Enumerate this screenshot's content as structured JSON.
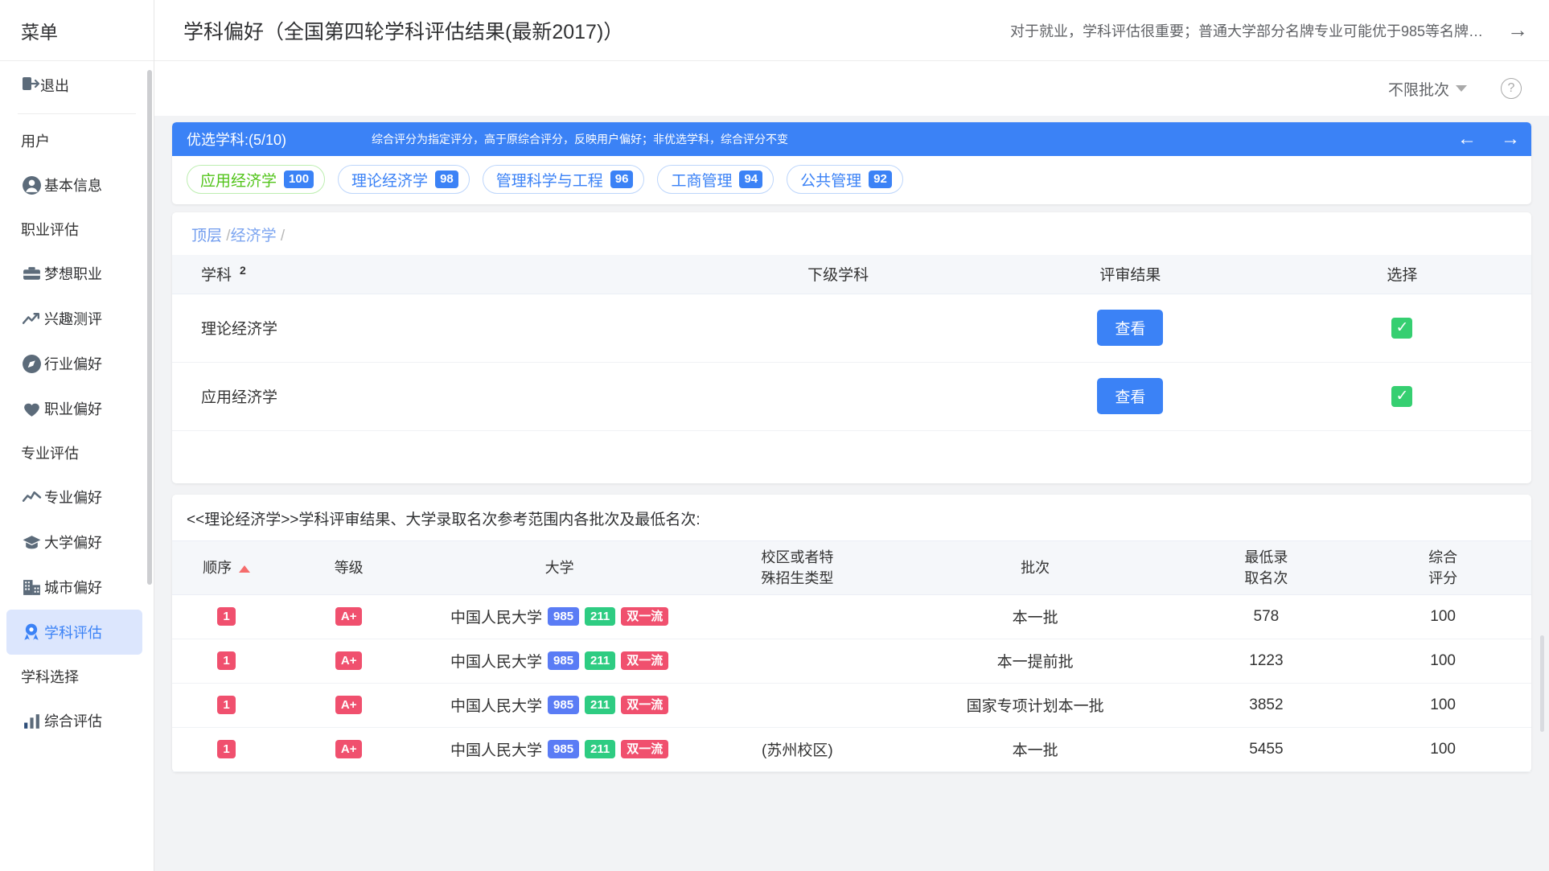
{
  "sidebar": {
    "header_label": "菜单",
    "logout_label": "退出",
    "groups": [
      {
        "title": "用户",
        "items": [
          {
            "label": "基本信息",
            "icon": "user-circle-icon",
            "active": false
          }
        ]
      },
      {
        "title": "职业评估",
        "items": [
          {
            "label": "梦想职业",
            "icon": "briefcase-icon",
            "active": false
          },
          {
            "label": "兴趣测评",
            "icon": "trend-up-icon",
            "active": false
          },
          {
            "label": "行业偏好",
            "icon": "compass-icon",
            "active": false
          },
          {
            "label": "职业偏好",
            "icon": "heart-icon",
            "active": false
          }
        ]
      },
      {
        "title": "专业评估",
        "items": [
          {
            "label": "专业偏好",
            "icon": "line-chart-icon",
            "active": false
          },
          {
            "label": "大学偏好",
            "icon": "graduation-cap-icon",
            "active": false
          },
          {
            "label": "城市偏好",
            "icon": "building-icon",
            "active": false
          },
          {
            "label": "学科评估",
            "icon": "award-badge-icon",
            "active": true
          }
        ]
      },
      {
        "title": "学科选择",
        "items": [
          {
            "label": "综合评估",
            "icon": "bar-chart-icon",
            "active": false
          }
        ]
      }
    ]
  },
  "topbar": {
    "title": "学科偏好（全国第四轮学科评估结果(最新2017)）",
    "notice": "对于就业，学科评估很重要；普通大学部分名牌专业可能优于985等名牌…",
    "notice_arrow_icon": "arrow-right-icon"
  },
  "subbar": {
    "batch_filter_value": "不限批次",
    "batch_filter_caret_icon": "chevron-down-icon",
    "help_icon": "question-mark-circle-icon",
    "help_label": "?"
  },
  "preferred": {
    "banner_title": "优选学科:(5/10)",
    "banner_note": "综合评分为指定评分，高于原综合评分，反映用户偏好；非优选学科，综合评分不变",
    "prev_icon": "arrow-left-icon",
    "prev_label": "←",
    "next_icon": "arrow-right-icon",
    "next_label": "→",
    "chips": [
      {
        "label": "应用经济学",
        "score": "100",
        "color": "green"
      },
      {
        "label": "理论经济学",
        "score": "98",
        "color": "blue"
      },
      {
        "label": "管理科学与工程",
        "score": "96",
        "color": "blue"
      },
      {
        "label": "工商管理",
        "score": "94",
        "color": "blue"
      },
      {
        "label": "公共管理",
        "score": "92",
        "color": "blue"
      }
    ]
  },
  "discipline_panel": {
    "breadcrumb": [
      {
        "label": "顶层"
      },
      {
        "label": "经济学"
      }
    ],
    "breadcrumb_separator": "/",
    "columns": [
      {
        "label": "学科",
        "sup": "2"
      },
      {
        "label": "下级学科"
      },
      {
        "label": "评审结果"
      },
      {
        "label": "选择"
      }
    ],
    "rows": [
      {
        "discipline": "理论经济学",
        "sub_discipline": "",
        "action_label": "查看",
        "selected": true,
        "check_icon": "check-icon",
        "check_glyph": "✓"
      },
      {
        "discipline": "应用经济学",
        "sub_discipline": "",
        "action_label": "查看",
        "selected": true,
        "check_icon": "check-icon",
        "check_glyph": "✓"
      }
    ]
  },
  "result_panel": {
    "title": "<<理论经济学>>学科评审结果、大学录取名次参考范围内各批次及最低名次:",
    "columns": [
      {
        "label": "顺序",
        "sorted": true,
        "sort_icon": "sort-ascending-icon"
      },
      {
        "label": "等级"
      },
      {
        "label": "大学"
      },
      {
        "label": "校区或者特\n殊招生类型",
        "line1": "校区或者特",
        "line2": "殊招生类型"
      },
      {
        "label": "批次"
      },
      {
        "label": "最低录\n取名次",
        "line1": "最低录",
        "line2": "取名次"
      },
      {
        "label": "综合\n评分",
        "line1": "综合",
        "line2": "评分"
      }
    ],
    "rows": [
      {
        "rank": "1",
        "grade": "A+",
        "university": "中国人民大学",
        "tags": [
          "985",
          "211",
          "双一流"
        ],
        "campus": "",
        "batch": "本一批",
        "min_rank": "578",
        "score": "100"
      },
      {
        "rank": "1",
        "grade": "A+",
        "university": "中国人民大学",
        "tags": [
          "985",
          "211",
          "双一流"
        ],
        "campus": "",
        "batch": "本一提前批",
        "min_rank": "1223",
        "score": "100"
      },
      {
        "rank": "1",
        "grade": "A+",
        "university": "中国人民大学",
        "tags": [
          "985",
          "211",
          "双一流"
        ],
        "campus": "",
        "batch": "国家专项计划本一批",
        "min_rank": "3852",
        "score": "100"
      },
      {
        "rank": "1",
        "grade": "A+",
        "university": "中国人民大学",
        "tags": [
          "985",
          "211",
          "双一流"
        ],
        "campus": "(苏州校区)",
        "batch": "本一批",
        "min_rank": "5455",
        "score": "100"
      }
    ]
  },
  "colors": {
    "primary_blue": "#3b82f6",
    "green": "#52c41a",
    "check_green": "#36cf71",
    "tag_red": "#f0506e",
    "tag_985": "#5a7cf5",
    "tag_211": "#2ecc82",
    "sidebar_active_bg": "#dce6fd"
  }
}
